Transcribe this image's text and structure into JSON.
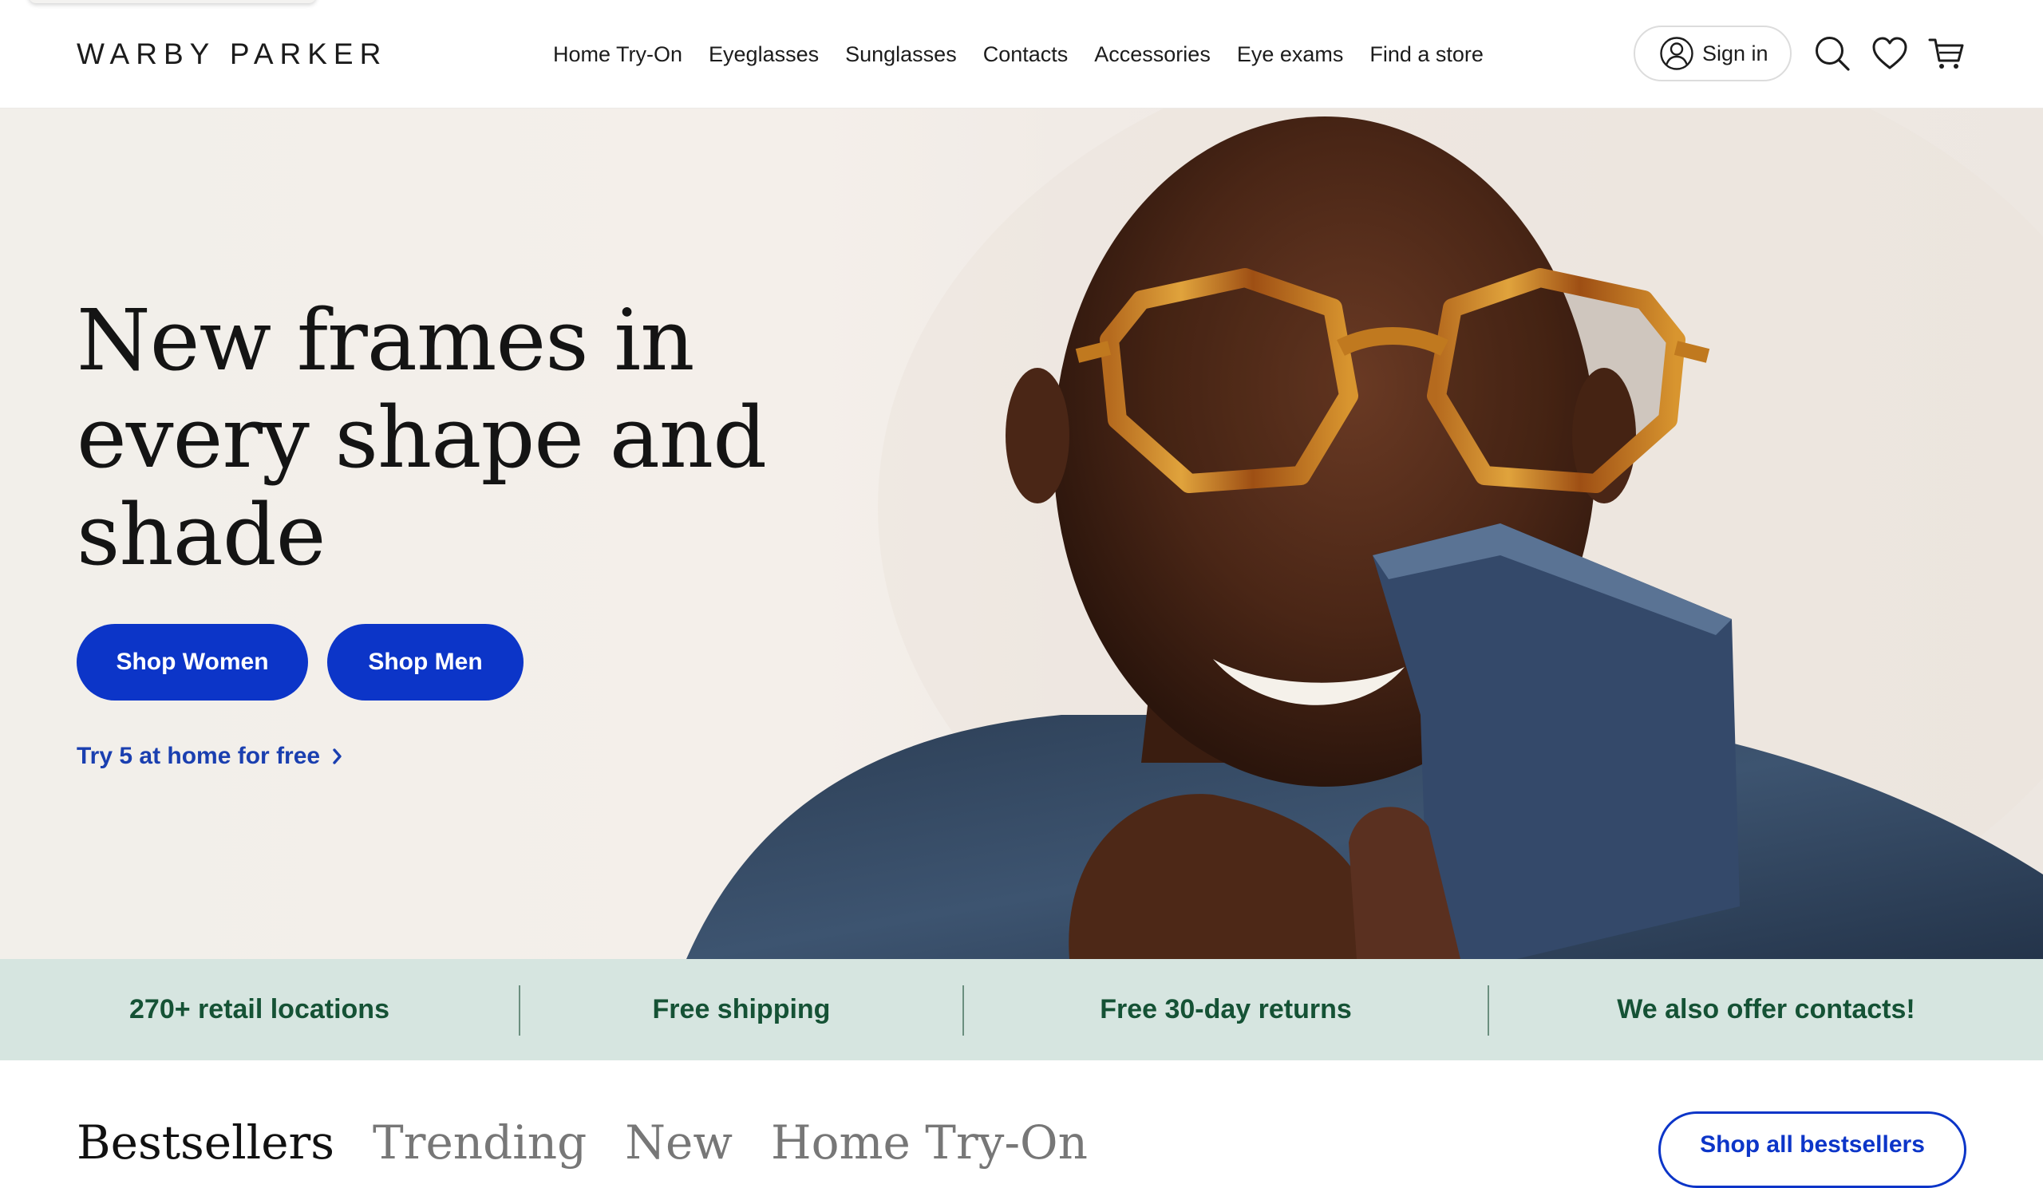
{
  "header": {
    "logo": "WARBY PARKER",
    "nav": [
      "Home Try-On",
      "Eyeglasses",
      "Sunglasses",
      "Contacts",
      "Accessories",
      "Eye exams",
      "Find a store"
    ],
    "sign_in": "Sign in",
    "icons": [
      "user-icon",
      "search-icon",
      "heart-icon",
      "cart-icon"
    ]
  },
  "hero": {
    "title": "New frames in every shape and shade",
    "shop_women": "Shop Women",
    "shop_men": "Shop Men",
    "try_link": "Try 5 at home for free",
    "button_color": "#0c35c8"
  },
  "features": [
    "270+ retail locations",
    "Free shipping",
    "Free 30-day returns",
    "We also offer contacts!"
  ],
  "products": {
    "tabs": [
      "Bestsellers",
      "Trending",
      "New",
      "Home Try-On"
    ],
    "active_tab": "Bestsellers",
    "shop_all": "Shop all bestsellers"
  },
  "colors": {
    "accent": "#0c35c8",
    "strip_bg": "#d6e5e0",
    "strip_text": "#155235"
  }
}
